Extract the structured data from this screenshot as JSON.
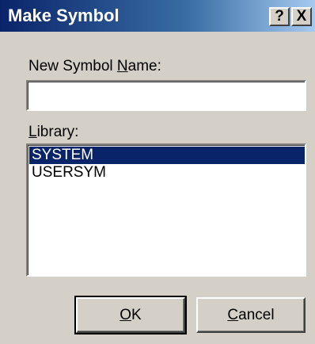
{
  "window": {
    "title": "Make Symbol",
    "help_glyph": "?",
    "close_glyph": "X"
  },
  "name_field": {
    "label_pre": "New Symbol ",
    "label_mnemonic": "N",
    "label_post": "ame:",
    "value": ""
  },
  "library": {
    "label_mnemonic": "L",
    "label_post": "ibrary:",
    "items": [
      {
        "label": "SYSTEM",
        "selected": true
      },
      {
        "label": "USERSYM",
        "selected": false
      }
    ]
  },
  "buttons": {
    "ok_mnemonic": "O",
    "ok_post": "K",
    "cancel_mnemonic": "C",
    "cancel_post": "ancel"
  },
  "colors": {
    "face": "#d4d0c8",
    "titlebar": "#0a246a",
    "selection": "#0a246a"
  }
}
